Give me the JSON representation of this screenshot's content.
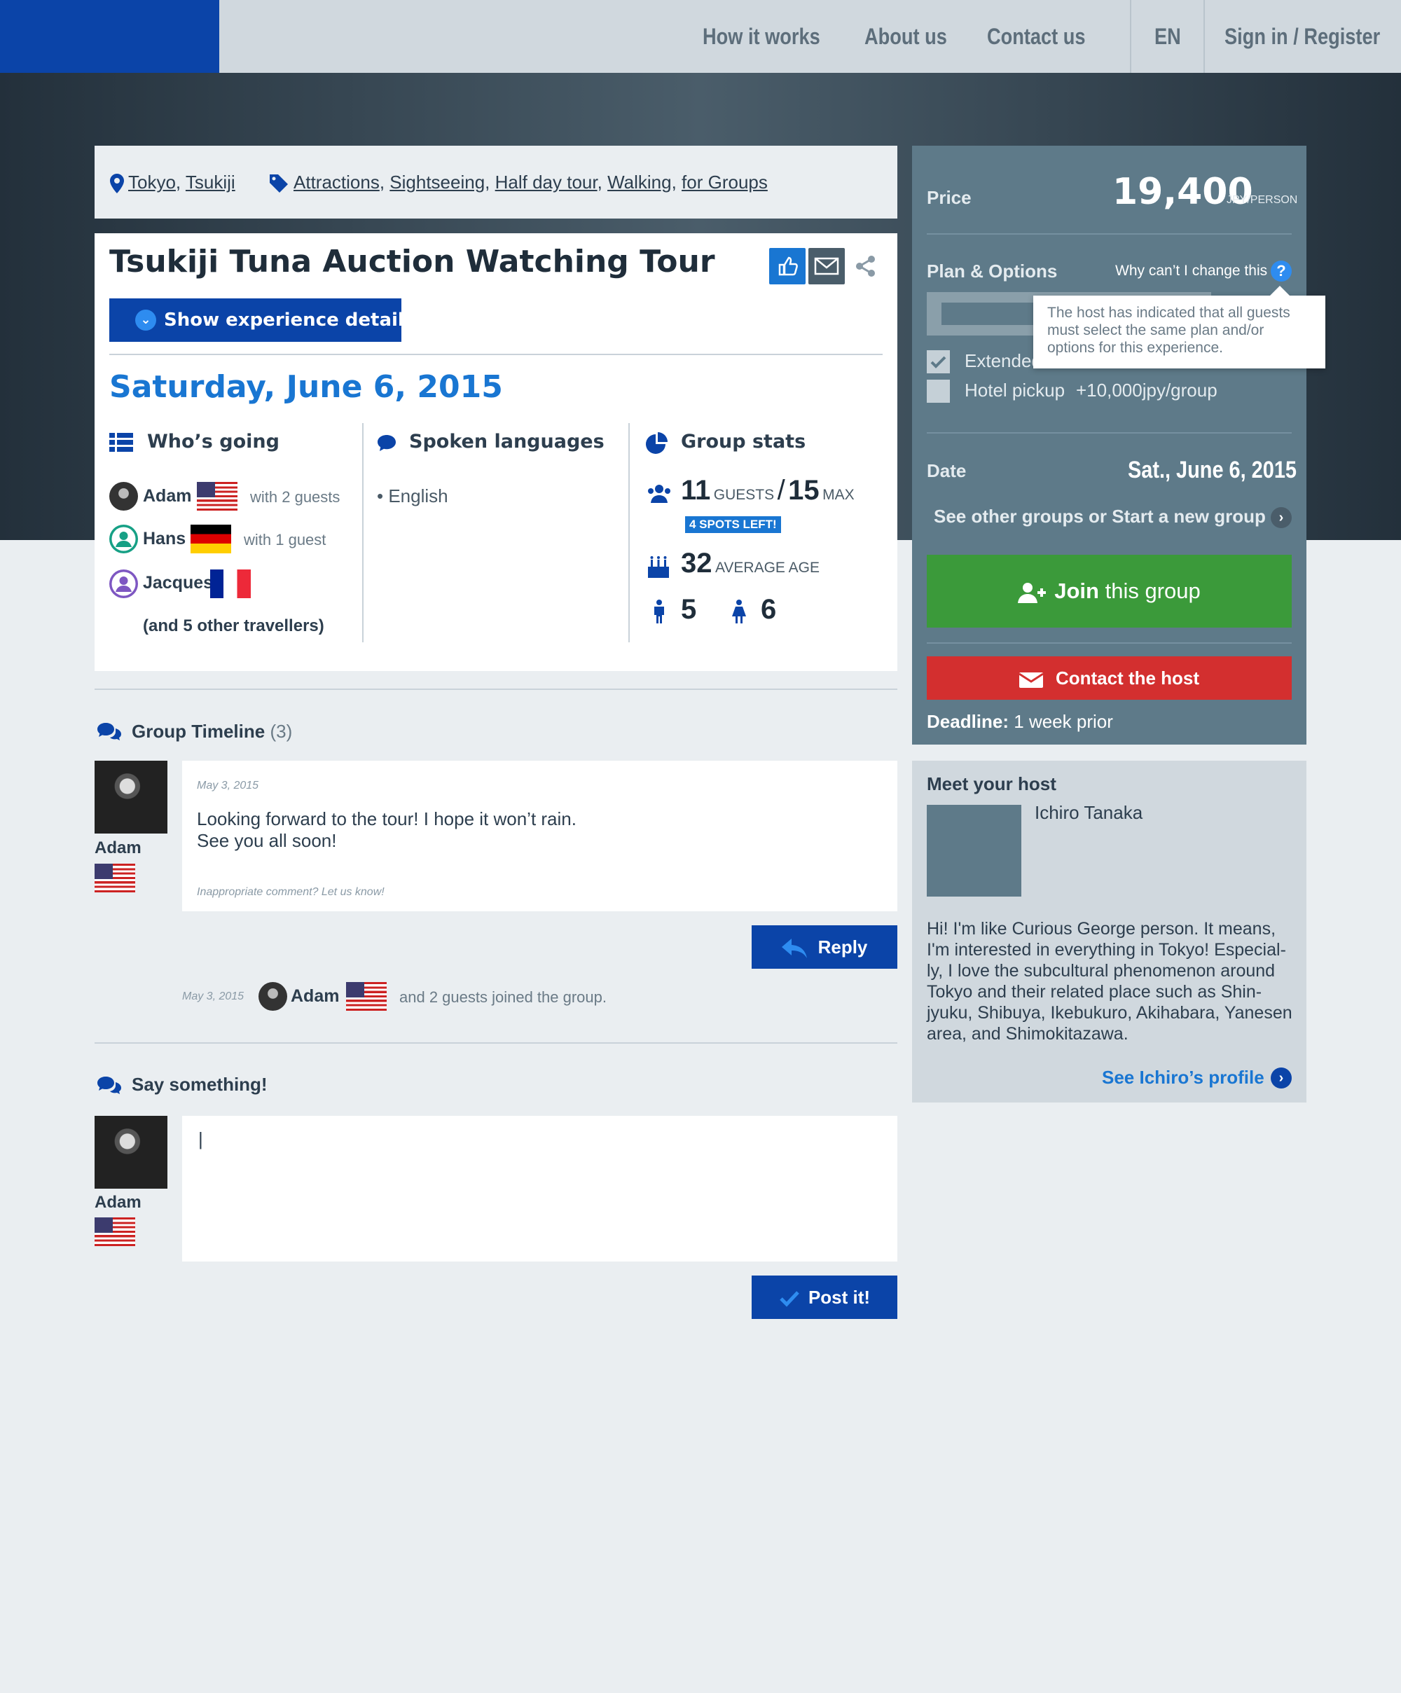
{
  "nav": {
    "items": [
      "How it works",
      "About us",
      "Contact us"
    ],
    "language": "EN",
    "signin": "Sign in / Register"
  },
  "crumbs": {
    "locations": [
      "Tokyo",
      "Tsukiji"
    ],
    "tags": [
      "Attractions",
      "Sightseeing",
      "Half day tour",
      "Walking",
      "for Groups"
    ]
  },
  "experience": {
    "title": "Tsukiji Tuna Auction Watching Tour",
    "show_details": "Show experience details",
    "date": "Saturday, June 6, 2015"
  },
  "whos_going": {
    "heading": "Who’s going",
    "people": [
      {
        "name": "Adam",
        "note": "with 2 guests"
      },
      {
        "name": "Hans",
        "note": "with 1 guest"
      },
      {
        "name": "Jacques",
        "note": ""
      }
    ],
    "others": "(and 5 other travellers)"
  },
  "languages": {
    "heading": "Spoken languages",
    "items": [
      "• English"
    ]
  },
  "stats": {
    "heading": "Group stats",
    "guests": "11",
    "guests_label": "GUESTS",
    "slash": "/",
    "max": "15",
    "max_label": "MAX",
    "spots_left": "4 SPOTS LEFT!",
    "avg_age": "32",
    "avg_age_label": "AVERAGE AGE",
    "male": "5",
    "female": "6"
  },
  "sidebar": {
    "price_label": "Price",
    "price": "19,400",
    "price_unit": "JPY/PERSON",
    "plan_label": "Plan & Options",
    "why_change": "Why can’t I change this",
    "tooltip": "The host has indicated that all guests must select the same plan and/or options for this experience.",
    "options": [
      {
        "label": "Extended",
        "checked": true
      },
      {
        "label": "Hotel pickup",
        "price": "+10,000jpy/group",
        "checked": false
      }
    ],
    "date_label": "Date",
    "date": "Sat., June 6, 2015",
    "other_groups": "See other groups or Start a new group",
    "join_strong": "Join",
    "join_rest": " this group",
    "contact": "Contact the host",
    "deadline_label": "Deadline:",
    "deadline": " 1 week prior"
  },
  "host": {
    "heading": "Meet your host",
    "name": "Ichiro Tanaka",
    "bio": [
      "Hi! I'm like Curious George person. It means,",
      "I'm interested in everything in Tokyo! Especial-",
      "ly, I love the subcultural phenomenon around",
      "Tokyo and their related place such as Shin-",
      "jyuku, Shibuya, Ikebukuro, Akihabara, Yanesen",
      "area, and Shimokitazawa."
    ],
    "profile_link": "See Ichiro’s profile"
  },
  "timeline": {
    "heading": "Group Timeline",
    "count": "(3)",
    "comment": {
      "author": "Adam",
      "date": "May 3, 2015",
      "lines": [
        "Looking forward to the tour! I hope it won’t rain.",
        "See you all soon!"
      ],
      "report": "Inappropriate comment? Let us know!"
    },
    "reply": "Reply",
    "event": {
      "date": "May 3, 2015",
      "author": "Adam",
      "text": "and 2 guests joined the group."
    }
  },
  "say": {
    "heading": "Say something!",
    "author": "Adam",
    "value": "|",
    "post": "Post it!"
  },
  "colors": {
    "brand": "#0b44a8",
    "accent": "#1976d2",
    "join": "#3b9a3a",
    "contact": "#d32f2f",
    "sidebar": "#5e7a89"
  }
}
